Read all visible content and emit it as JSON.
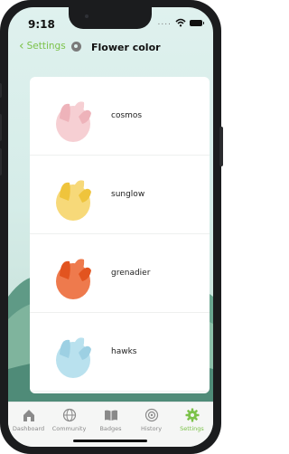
{
  "status_bar": {
    "time": "9:18",
    "signal": "...."
  },
  "nav": {
    "back_label": "Settings",
    "title": "Flower color"
  },
  "flowers": [
    {
      "name": "cosmos",
      "color": "#f6cfd3",
      "accent": "#eeb3ba"
    },
    {
      "name": "sunglow",
      "color": "#f7d979",
      "accent": "#efc43c"
    },
    {
      "name": "grenadier",
      "color": "#ee7a4d",
      "accent": "#e2541f"
    },
    {
      "name": "hawks",
      "color": "#b9e1ee",
      "accent": "#9dd0e3"
    }
  ],
  "tabs": [
    {
      "label": "Dashboard",
      "icon": "home-icon",
      "active": false
    },
    {
      "label": "Community",
      "icon": "globe-icon",
      "active": false
    },
    {
      "label": "Badges",
      "icon": "book-icon",
      "active": false
    },
    {
      "label": "History",
      "icon": "target-icon",
      "active": false
    },
    {
      "label": "Settings",
      "icon": "gear-icon",
      "active": true
    }
  ],
  "colors": {
    "accent": "#7cc24a",
    "inactive": "#8a8a8a"
  }
}
